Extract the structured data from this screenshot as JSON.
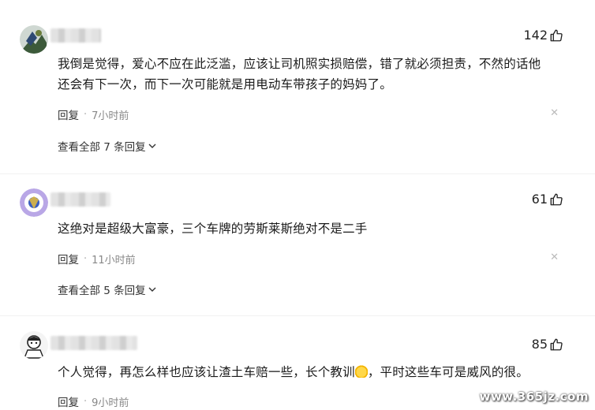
{
  "comments": [
    {
      "likes": "142",
      "text_line1": "我倒是觉得，爱心不应在此泛滥，应该让司机照实损赔偿，错了就必须担责，不然的话他",
      "text_line2": "还会有下一次，而下一次可能就是用电动车带孩子的妈妈了。",
      "reply_label": "回复",
      "time": "7小时前",
      "view_all": "查看全部 7 条回复"
    },
    {
      "likes": "61",
      "text_line1": "这绝对是超级大富豪，三个车牌的劳斯莱斯绝对不是二手",
      "reply_label": "回复",
      "time": "11小时前",
      "view_all": "查看全部 5 条回复"
    },
    {
      "likes": "85",
      "text_part1": "个人觉得，再怎么样也应该让渣土车赔一些，长个教训",
      "text_part2": "，平时这些车可是威风的很。",
      "reply_label": "回复",
      "time": "9小时前"
    }
  ],
  "watermark": "www.365jz.com",
  "icons": {
    "like": "thumbs-up-icon",
    "close": "close-icon",
    "expand": "chevron-down-icon"
  },
  "colors": {
    "text": "#1a1a1a",
    "meta": "#888888",
    "close": "#bbbbbb"
  }
}
